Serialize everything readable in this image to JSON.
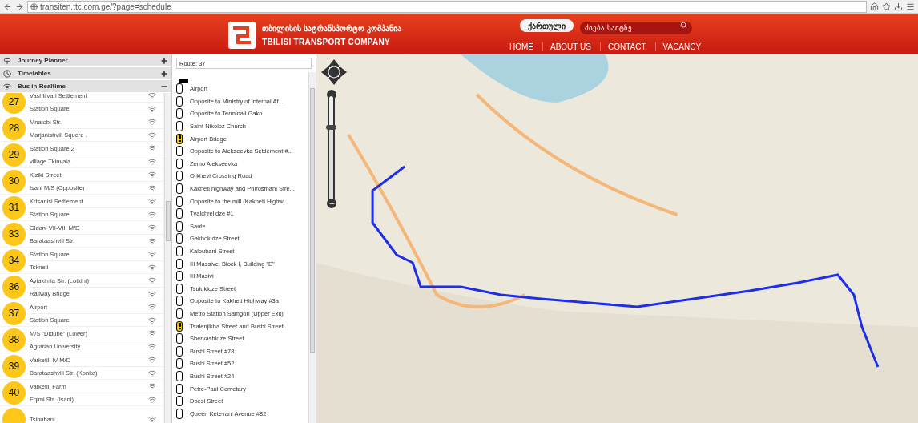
{
  "browser": {
    "url": "transiten.ttc.com.ge/?page=schedule"
  },
  "header": {
    "title_ka": "თბილისის სატრანსპორტო კომპანია",
    "title_en": "TBILISI TRANSPORT COMPANY",
    "language_button": "ქართული",
    "search": {
      "placeholder": "ძიება საიტზე"
    },
    "nav": [
      "HOME",
      "ABOUT US",
      "CONTACT",
      "VACANCY"
    ]
  },
  "sidebar": {
    "sections": [
      {
        "kind": "planner",
        "label": "Journey Planner",
        "expanded": false
      },
      {
        "kind": "timetables",
        "label": "Timetables",
        "expanded": false
      },
      {
        "kind": "realtime",
        "label": "Bus in Realtime",
        "expanded": true
      }
    ],
    "routes": [
      {
        "number": "27",
        "from": "Vashlijvari Settlement",
        "to": "Station Square"
      },
      {
        "number": "28",
        "from": "Mnatobi Str.",
        "to": "Marjanishvili Squere ."
      },
      {
        "number": "29",
        "from": "Station Square 2",
        "to": "village Tkinvala"
      },
      {
        "number": "30",
        "from": "Kiziki Street",
        "to": "Isani M/S (Opposite)"
      },
      {
        "number": "31",
        "from": "Krtsanisi Settlement",
        "to": "Station Square"
      },
      {
        "number": "33",
        "from": "Gldani VII-VIII M/D",
        "to": "Barataashvili Str."
      },
      {
        "number": "34",
        "from": "Station Square",
        "to": "Tskneti"
      },
      {
        "number": "36",
        "from": "Aviakimia Str. (Lotkini)",
        "to": "Railway Bridge"
      },
      {
        "number": "37",
        "from": "Airport",
        "to": "Station Square"
      },
      {
        "number": "38",
        "from": "M/S \"Didube\" (Lower)",
        "to": "Agrarian University"
      },
      {
        "number": "39",
        "from": "Varketili IV M/D",
        "to": "Barataashvili Str. (Konka)"
      },
      {
        "number": "40",
        "from": "Varketili Farm",
        "to": "Eqimi Str. (Isani)"
      },
      {
        "from": "Tsinubani"
      }
    ]
  },
  "route_panel": {
    "title": "Route: 37",
    "stops": [
      {
        "name": "Airport",
        "alert": false
      },
      {
        "name": "Opposite to Ministry of Internal Af...",
        "alert": false
      },
      {
        "name": "Opposite to Terminali Gako",
        "alert": false
      },
      {
        "name": "Saint Nikoloz Church",
        "alert": false
      },
      {
        "name": "Airport Bridge",
        "alert": true
      },
      {
        "name": "Opposite to Alekseevka Settlement #...",
        "alert": false
      },
      {
        "name": "Zemo Alekseevka",
        "alert": false
      },
      {
        "name": "Orkhevi Crossing Road",
        "alert": false
      },
      {
        "name": "Kakheti highway and Phirosmani Stre...",
        "alert": false
      },
      {
        "name": "Opposite to the mill (Kakheti Highw...",
        "alert": false
      },
      {
        "name": "Tvalchrelidze #1",
        "alert": false
      },
      {
        "name": "Sante",
        "alert": false
      },
      {
        "name": "Gakhokidze Street",
        "alert": false
      },
      {
        "name": "Kaloubani Street",
        "alert": false
      },
      {
        "name": "III Massive, Block I, Building \"E\"",
        "alert": false
      },
      {
        "name": "III Masivi",
        "alert": false
      },
      {
        "name": "Tsulukidze Street",
        "alert": false
      },
      {
        "name": "Opposite to Kakheti Highway #3a",
        "alert": false
      },
      {
        "name": "Metro Station Samgori (Upper Exit)",
        "alert": false
      },
      {
        "name": "Tsalenjikha Street and Bushi Street...",
        "alert": true
      },
      {
        "name": "Shervashidze Street",
        "alert": false
      },
      {
        "name": "Bushi Street #78",
        "alert": false
      },
      {
        "name": "Bushi Street #52",
        "alert": false
      },
      {
        "name": "Bushi Street #24",
        "alert": false
      },
      {
        "name": "Petre-Paul Cemetary",
        "alert": false
      },
      {
        "name": "Doesi Street",
        "alert": false
      },
      {
        "name": "Queen Ketevani Avenue #82",
        "alert": false
      }
    ]
  },
  "map": {
    "zoom": {
      "level": 0.7
    }
  }
}
